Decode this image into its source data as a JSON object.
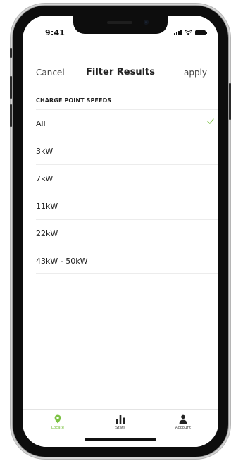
{
  "status_bar": {
    "time": "9:41",
    "icons": [
      "signal-icon",
      "wifi-icon",
      "battery-icon"
    ]
  },
  "nav": {
    "cancel_label": "Cancel",
    "title": "Filter Results",
    "apply_label": "apply"
  },
  "filter": {
    "section_title": "CHARGE POINT SPEEDS",
    "options": [
      {
        "label": "All",
        "selected": true
      },
      {
        "label": "3kW",
        "selected": false
      },
      {
        "label": "7kW",
        "selected": false
      },
      {
        "label": "11kW",
        "selected": false
      },
      {
        "label": "22kW",
        "selected": false
      },
      {
        "label": "43kW - 50kW",
        "selected": false
      }
    ]
  },
  "tabs": [
    {
      "label": "Locate",
      "icon": "location-pin-icon",
      "active": true
    },
    {
      "label": "Stats",
      "icon": "bar-chart-icon",
      "active": false
    },
    {
      "label": "Account",
      "icon": "user-icon",
      "active": false
    }
  ],
  "colors": {
    "accent": "#7cc243",
    "text": "#222222",
    "divider": "#ececec"
  }
}
